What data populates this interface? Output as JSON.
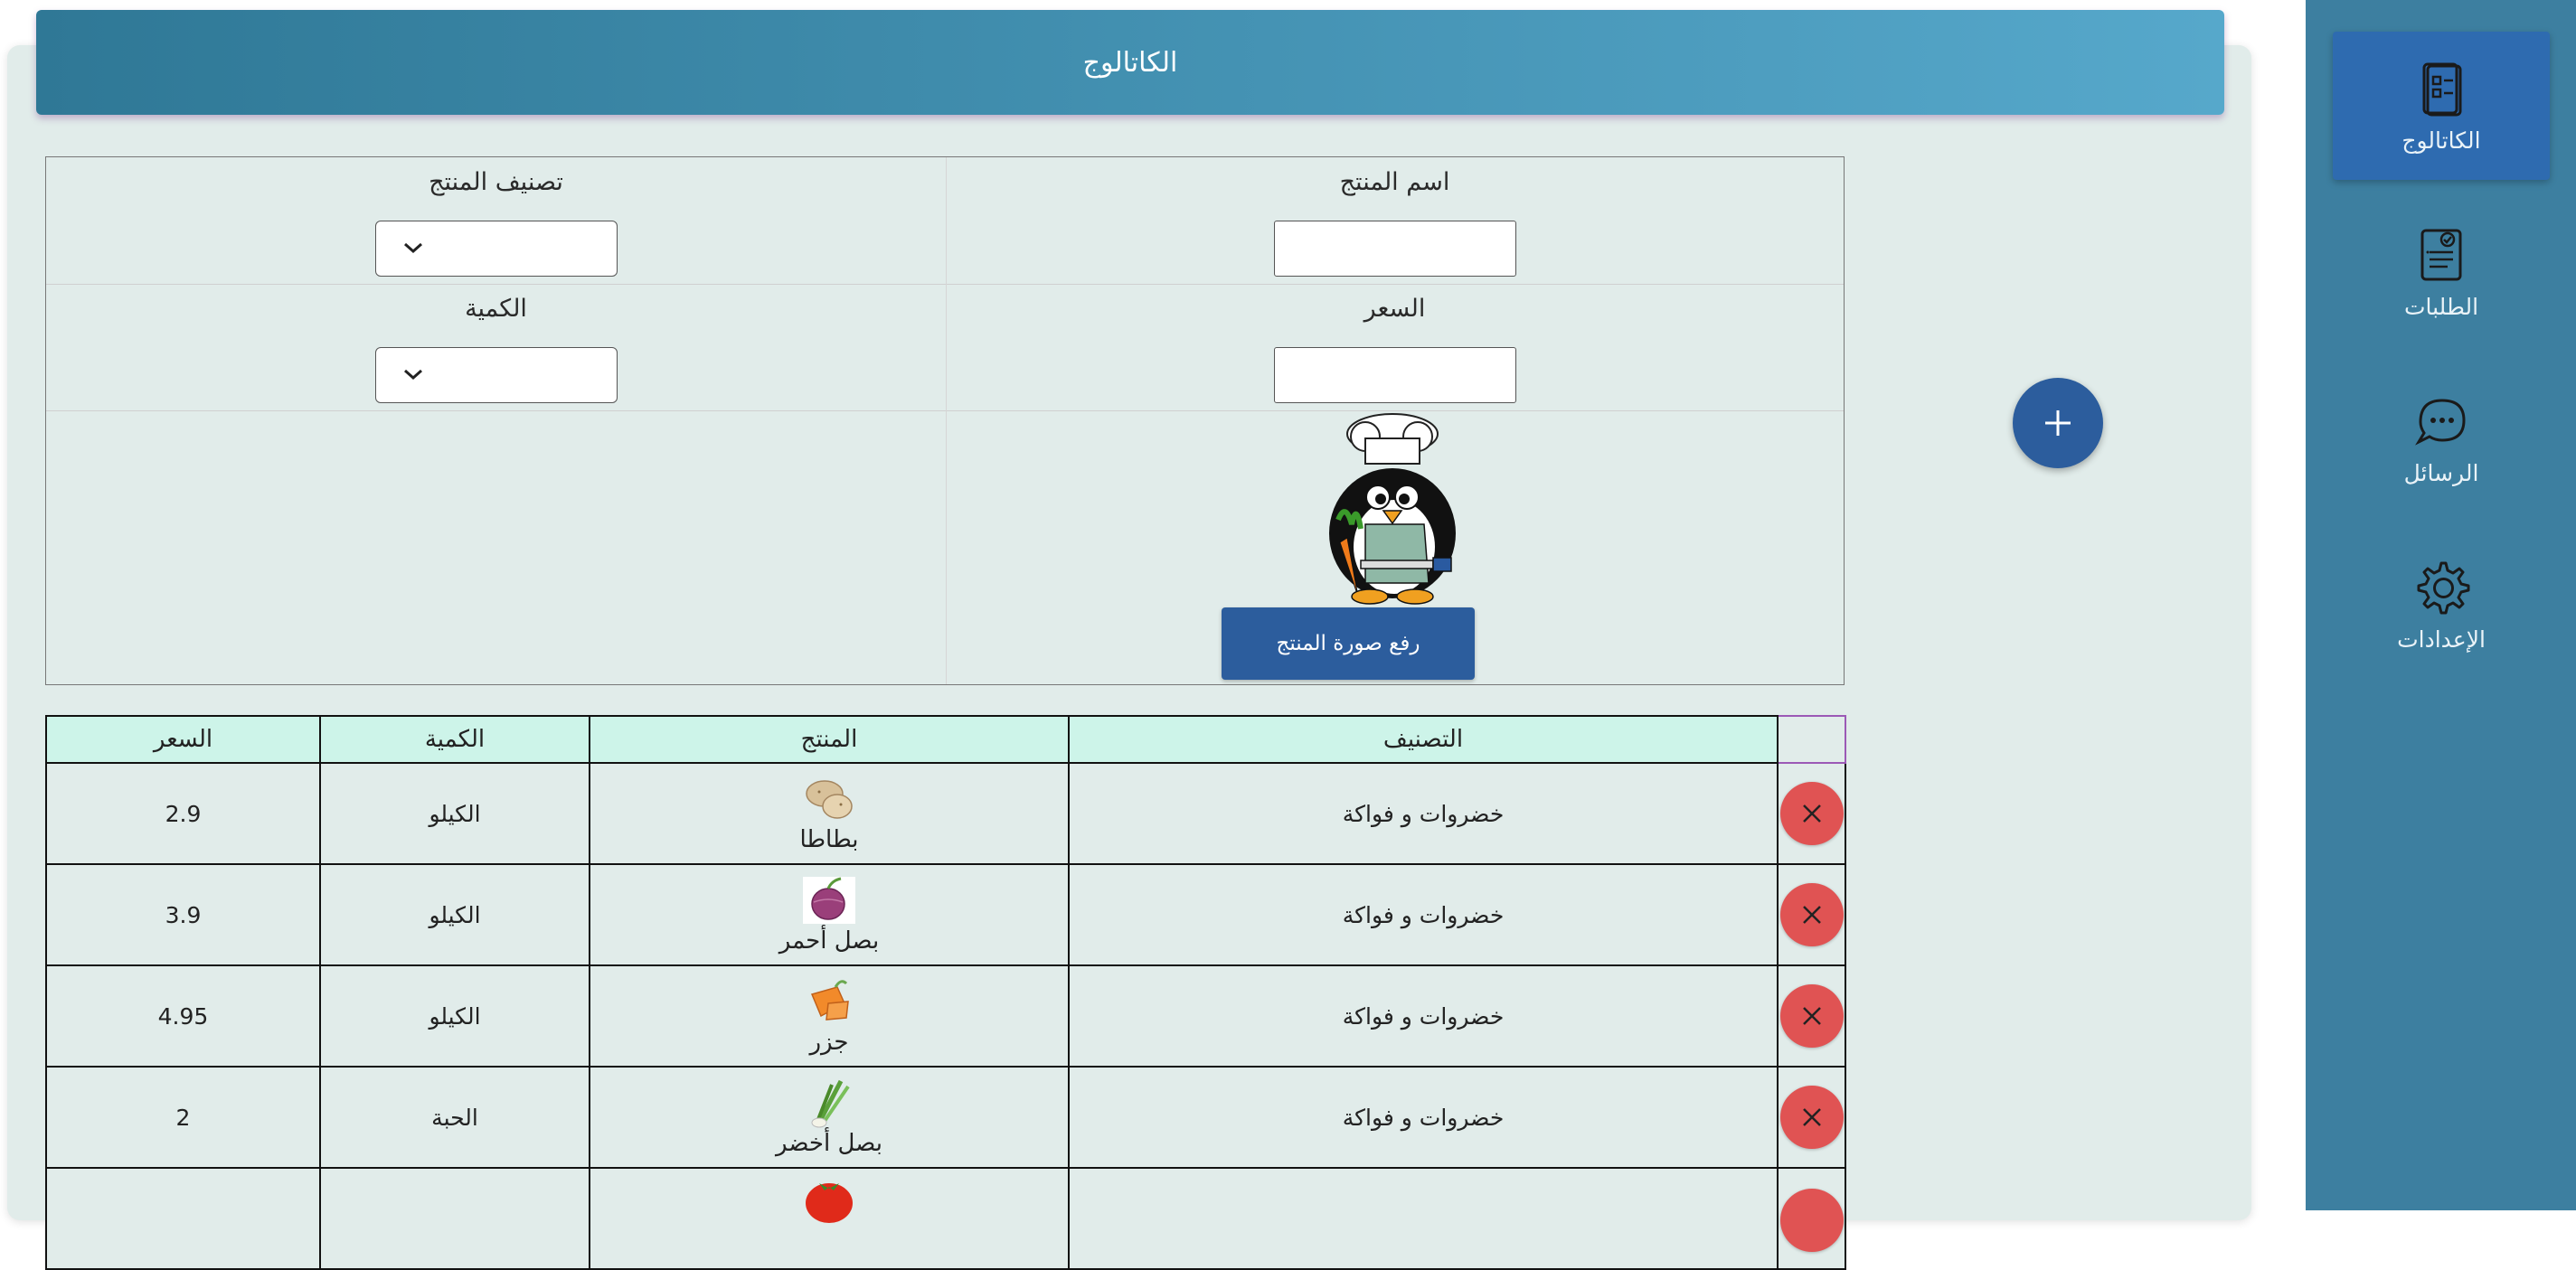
{
  "header": {
    "title": "الكاتالوج"
  },
  "form": {
    "product_name_label": "اسم المنتج",
    "category_label": "تصنيف المنتج",
    "price_label": "السعر",
    "quantity_label": "الكمية",
    "upload_button": "رفع صورة المنتج"
  },
  "table": {
    "headers": {
      "category": "التصنيف",
      "product": "المنتج",
      "quantity": "الكمية",
      "price": "السعر"
    },
    "rows": [
      {
        "category": "خضروات و فواكة",
        "product": "بطاطا",
        "unit": "الكيلو",
        "price": "2.9",
        "icon": "potato-icon"
      },
      {
        "category": "خضروات و فواكة",
        "product": "بصل أحمر",
        "unit": "الكيلو",
        "price": "3.9",
        "icon": "red-onion-icon"
      },
      {
        "category": "خضروات و فواكة",
        "product": "جزر",
        "unit": "الكيلو",
        "price": "4.95",
        "icon": "carrot-icon"
      },
      {
        "category": "خضروات و فواكة",
        "product": "بصل أخضر",
        "unit": "الحبة",
        "price": "2",
        "icon": "green-onion-icon"
      },
      {
        "category": "",
        "product": "",
        "unit": "",
        "price": "",
        "icon": "tomato-icon"
      }
    ]
  },
  "sidebar": {
    "items": [
      {
        "label": "الكاتالوج",
        "icon": "catalog-icon",
        "active": true
      },
      {
        "label": "الطلبات",
        "icon": "orders-icon",
        "active": false
      },
      {
        "label": "الرسائل",
        "icon": "messages-icon",
        "active": false
      },
      {
        "label": "الإعدادات",
        "icon": "settings-icon",
        "active": false
      }
    ]
  },
  "colors": {
    "header_start": "#2f7896",
    "header_end": "#56a8cb",
    "sidebar": "#3d7fa0",
    "sidebar_active": "#2e6bb0",
    "panel_bg": "#e1ecea",
    "table_header": "#cdf4e9",
    "delete_button": "#e05353",
    "primary_button": "#2c5d9d"
  }
}
